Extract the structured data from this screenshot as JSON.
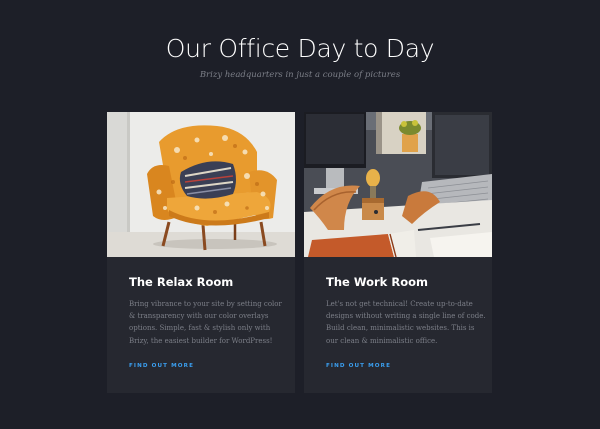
{
  "header": {
    "title": "Our Office Day to Day",
    "subtitle": "Brizy headquarters in just a couple of pictures"
  },
  "cards": [
    {
      "title": "The Relax Room",
      "text": "Bring vibrance to your site by setting color & transparency with our color overlays options. Simple, fast & stylish only with Brizy, the easiest builder for WordPress!",
      "link_label": "FIND OUT MORE"
    },
    {
      "title": "The Work Room",
      "text": "Let's not get technical! Create up-to-date designs without writing a single line of code. Build clean, minimalistic websites. This is our clean & minimalistic office.",
      "link_label": "FIND OUT MORE"
    }
  ],
  "colors": {
    "background": "#1d1f28",
    "card_background": "#262830",
    "accent": "#3a9ff0",
    "heading": "#ffffff",
    "body_text": "#7c7f88"
  }
}
